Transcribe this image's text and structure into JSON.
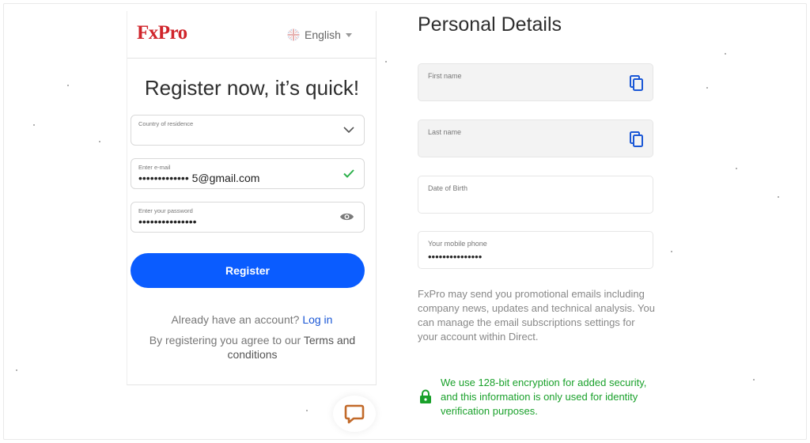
{
  "brand": {
    "logo": "FxPro",
    "accent": "#0a5cff",
    "brand_red": "#d0252b"
  },
  "language": {
    "selected": "English",
    "icon": "uk-flag-icon"
  },
  "register": {
    "title": "Register now, it’s quick!",
    "country": {
      "label": "Country of residence",
      "value": ""
    },
    "email": {
      "label": "Enter e-mail",
      "value": "•••••••••••••  5@gmail.com"
    },
    "password": {
      "label": "Enter your password",
      "value": "•••••••••••••••"
    },
    "button": "Register",
    "already_text": "Already have an account?",
    "login_link": "Log in",
    "terms_prefix": "By registering you agree to our",
    "terms_link": "Terms and conditions"
  },
  "personal": {
    "title": "Personal Details",
    "first_name": {
      "label": "First name",
      "value": ""
    },
    "last_name": {
      "label": "Last name",
      "value": ""
    },
    "dob": {
      "label": "Date of Birth",
      "value": ""
    },
    "phone": {
      "label": "Your mobile phone",
      "value": "•••••••••••••••"
    },
    "promo": "FxPro may send you promotional emails including company news, updates and technical analysis. You can manage the email subscriptions settings for your account within Direct.",
    "security": "We use 128-bit encryption for added security, and this information is only used for identity verification purposes.",
    "security_color": "#1aa12b"
  }
}
